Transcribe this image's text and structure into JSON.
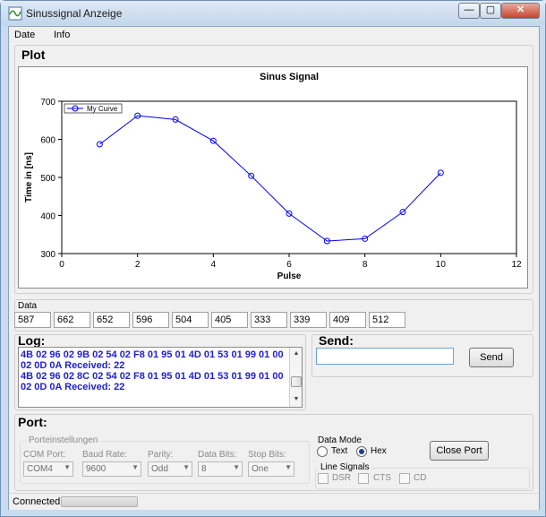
{
  "window": {
    "title": "Sinussignal Anzeige",
    "minimize": "—",
    "maximize": "▢",
    "close": "✕"
  },
  "menu": [
    "Date",
    "Info"
  ],
  "plot": {
    "section_title": "Plot",
    "chart_data": {
      "type": "line",
      "title": "Sinus Signal",
      "xlabel": "Pulse",
      "ylabel": "Time in [ns]",
      "xlim": [
        0,
        12
      ],
      "ylim": [
        300,
        700
      ],
      "x_ticks": [
        "0",
        "2",
        "4",
        "6",
        "8",
        "10",
        "12"
      ],
      "y_ticks": [
        "300",
        "400",
        "500",
        "600",
        "700"
      ],
      "legend_position": "top-left",
      "series": [
        {
          "name": "My Curve",
          "color": "#0000ff",
          "x": [
            1,
            2,
            3,
            4,
            5,
            6,
            7,
            8,
            9,
            10
          ],
          "y": [
            587,
            662,
            652,
            596,
            504,
            405,
            333,
            339,
            409,
            512
          ]
        }
      ]
    }
  },
  "data": {
    "label": "Data",
    "values": [
      "587",
      "662",
      "652",
      "596",
      "504",
      "405",
      "333",
      "339",
      "409",
      "512"
    ]
  },
  "log": {
    "title": "Log:",
    "lines": [
      "4B 02 96 02 9B 02 54 02 F8 01 95 01 4D 01 53 01 99 01 00",
      "02 0D 0A  Received: 22",
      "4B 02 96 02 8C 02 54 02 F8 01 95 01 4D 01 53 01 99 01 00",
      "02 0D 0A  Received: 22"
    ]
  },
  "send": {
    "title": "Send:",
    "input_value": "",
    "button": "Send"
  },
  "port": {
    "title": "Port:",
    "settings_group": "Porteinstellungen",
    "fields": [
      {
        "label": "COM Port:",
        "value": "COM4"
      },
      {
        "label": "Baud Rate:",
        "value": "9600"
      },
      {
        "label": "Parity:",
        "value": "Odd"
      },
      {
        "label": "Data Bits:",
        "value": "8"
      },
      {
        "label": "Stop Bits:",
        "value": "One"
      }
    ],
    "data_mode": {
      "label": "Data Mode",
      "text_option": "Text",
      "hex_option": "Hex",
      "selected": "Hex"
    },
    "close_button": "Close Port",
    "line_signals": {
      "label": "Line Signals",
      "dsr": "DSR",
      "cts": "CTS",
      "cd": "CD"
    }
  },
  "status": {
    "text": "Connected"
  }
}
